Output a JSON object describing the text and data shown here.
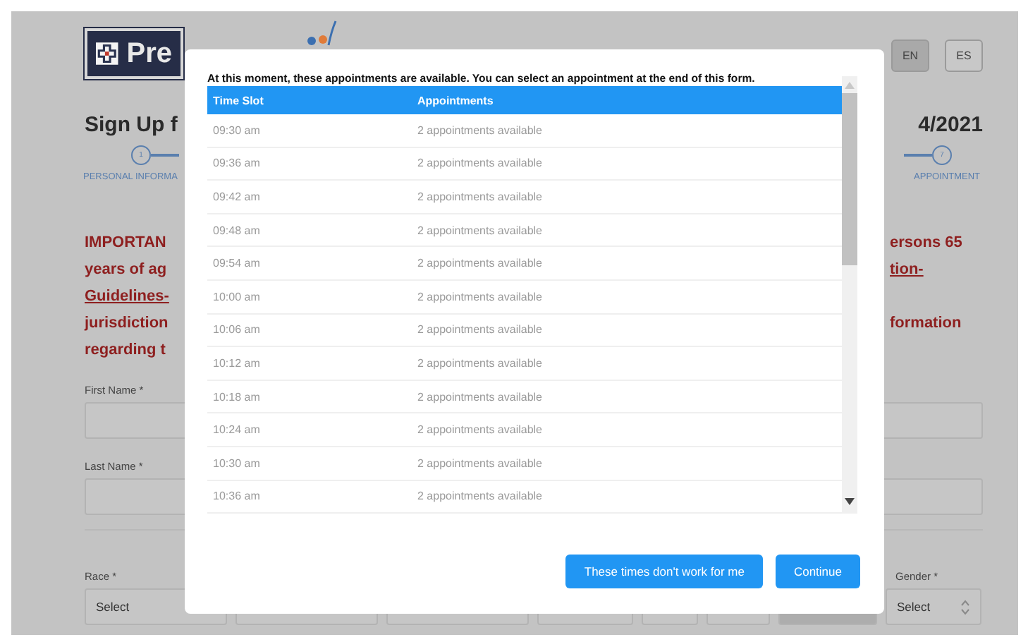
{
  "header": {
    "logo_text": "Pre",
    "languages": [
      {
        "label": "EN",
        "selected": true
      },
      {
        "label": "ES",
        "selected": false
      }
    ]
  },
  "title": {
    "left": "Sign Up f",
    "right": "4/2021"
  },
  "steps": [
    {
      "number": "1",
      "label": "PERSONAL INFORMA"
    },
    {
      "number": "7",
      "label": "APPOINTMENT"
    }
  ],
  "notice": [
    {
      "left": {
        "text": "IMPORTAN",
        "link": false
      },
      "right": {
        "text": "ersons 65",
        "link": false
      }
    },
    {
      "left": {
        "text": "years of ag",
        "link": false
      },
      "right": {
        "text": "tion-",
        "link": true
      }
    },
    {
      "left": {
        "text": "Guidelines-",
        "link": true
      }
    },
    {
      "left": {
        "text": "jurisdiction",
        "link": false
      },
      "right": {
        "text": "formation",
        "link": false
      }
    },
    {
      "left": {
        "text": "regarding t",
        "link": false
      }
    }
  ],
  "fields": [
    {
      "label": "First Name *"
    },
    {
      "label": "Last Name *"
    }
  ],
  "selects": {
    "left": {
      "label": "Race *",
      "value": "Select"
    },
    "right": {
      "label": "Gender *",
      "value": "Select"
    }
  },
  "modal": {
    "intro": "At this moment, these appointments are available. You can select an appointment at the end of this form.",
    "columns": [
      "Time Slot",
      "Appointments"
    ],
    "rows": [
      {
        "time": "09:30 am",
        "appointments": "2 appointments available"
      },
      {
        "time": "09:36 am",
        "appointments": "2 appointments available"
      },
      {
        "time": "09:42 am",
        "appointments": "2 appointments available"
      },
      {
        "time": "09:48 am",
        "appointments": "2 appointments available"
      },
      {
        "time": "09:54 am",
        "appointments": "2 appointments available"
      },
      {
        "time": "10:00 am",
        "appointments": "2 appointments available"
      },
      {
        "time": "10:06 am",
        "appointments": "2 appointments available"
      },
      {
        "time": "10:12 am",
        "appointments": "2 appointments available"
      },
      {
        "time": "10:18 am",
        "appointments": "2 appointments available"
      },
      {
        "time": "10:24 am",
        "appointments": "2 appointments available"
      },
      {
        "time": "10:30 am",
        "appointments": "2 appointments available"
      },
      {
        "time": "10:36 am",
        "appointments": "2 appointments available"
      }
    ],
    "buttons": [
      {
        "label": "These times don't work for me"
      },
      {
        "label": "Continue"
      }
    ]
  }
}
